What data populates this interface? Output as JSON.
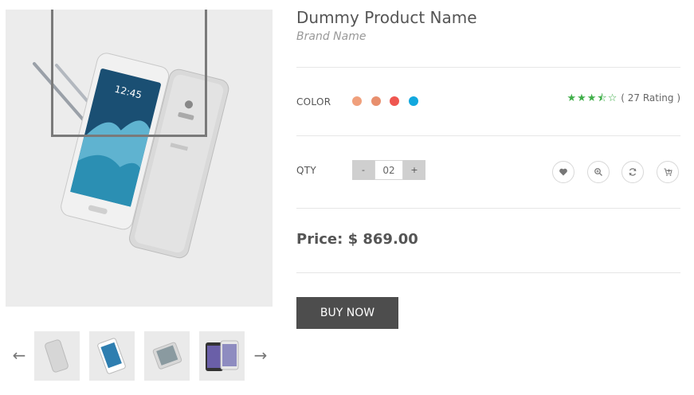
{
  "product": {
    "title": "Dummy Product Name",
    "brand": "Brand Name",
    "color_label": "COLOR",
    "colors": [
      "#f0a07c",
      "#e88f6d",
      "#ef5650",
      "#12a8de"
    ],
    "rating_stars": "★★★⯪☆",
    "rating_text": "( 27 Rating )",
    "rating_value": 3.5,
    "rating_max": 5,
    "qty_label": "QTY",
    "qty_minus": "-",
    "qty_value": "02",
    "qty_plus": "+",
    "price": "Price: $ 869.00",
    "buy_label": "BUY NOW"
  },
  "gallery": {
    "prev_icon": "←",
    "next_icon": "→",
    "thumb_count": 4
  },
  "icons": {
    "wishlist": "heart-icon",
    "zoom": "zoom-in-icon",
    "compare": "refresh-icon",
    "cart": "cart-icon"
  },
  "colors": {
    "button_bg": "#4d4d4d",
    "star_color": "#3fae49",
    "image_bg": "#ececec"
  }
}
